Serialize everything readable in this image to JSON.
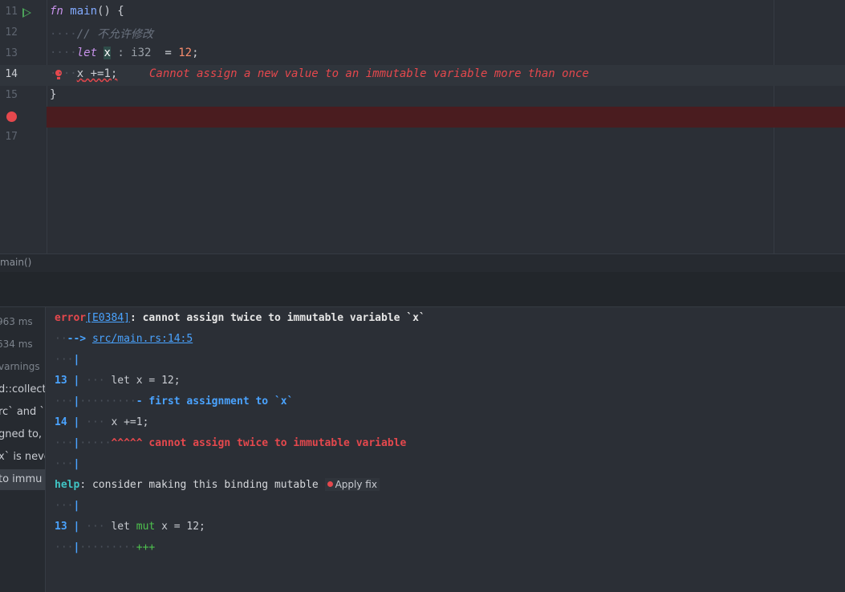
{
  "editor": {
    "lines": [
      {
        "num": "11"
      },
      {
        "num": "12",
        "comment": "// 不允许修改"
      },
      {
        "num": "13"
      },
      {
        "num": "14",
        "error": "Cannot assign a new value to an immutable variable more than once"
      },
      {
        "num": "15"
      },
      {
        "num": ""
      },
      {
        "num": "17"
      }
    ],
    "tokens": {
      "fn_kw": "fn",
      "main_name": "main",
      "main_rest": "() {",
      "let_kw": "let",
      "var_x": "x",
      "type_hint": ": i32",
      "assign": " = ",
      "val": "12",
      "semi": ";",
      "assign_stmt_x": "x",
      "assign_stmt_rest": " +=1;",
      "close_brace": "}"
    }
  },
  "breadcrumb": {
    "label": "main()"
  },
  "side_list": {
    "items": [
      {
        "text": "963 ms"
      },
      {
        "text": "634 ms"
      },
      {
        "text": "varnings"
      },
      {
        "text": "d::collecti"
      },
      {
        "text": "rc` and `"
      },
      {
        "text": "gned to, b"
      },
      {
        "text": "x` is neve"
      },
      {
        "text": " to immu"
      }
    ]
  },
  "output": {
    "error_word": "error",
    "error_code": "[E0384]",
    "error_msg": ": cannot assign twice to immutable variable `x`",
    "arrow": "-->",
    "location": "src/main.rs:14:5",
    "pipe": "|",
    "ln13": "13",
    "ln14": "14",
    "code13": "let x = 12;",
    "marker_first": "- first assignment to `x`",
    "code14": "x +=1;",
    "marker_cannot": "^^^^^ cannot assign twice to immutable variable",
    "help_word": "help",
    "help_msg": ": consider making this binding mutable",
    "apply_fix": "Apply fix",
    "fix_let": "let ",
    "fix_mut": "mut",
    "fix_rest": " x = 12;",
    "plus": "+++"
  },
  "colors": {
    "error": "#e5484d",
    "link": "#4aa3ff",
    "help": "#40c4c4",
    "added": "#4ec24e",
    "breakpoint_line": "#4a1c1f"
  },
  "icons": [
    "run-icon",
    "breakpoint-icon",
    "bulb-icon"
  ]
}
